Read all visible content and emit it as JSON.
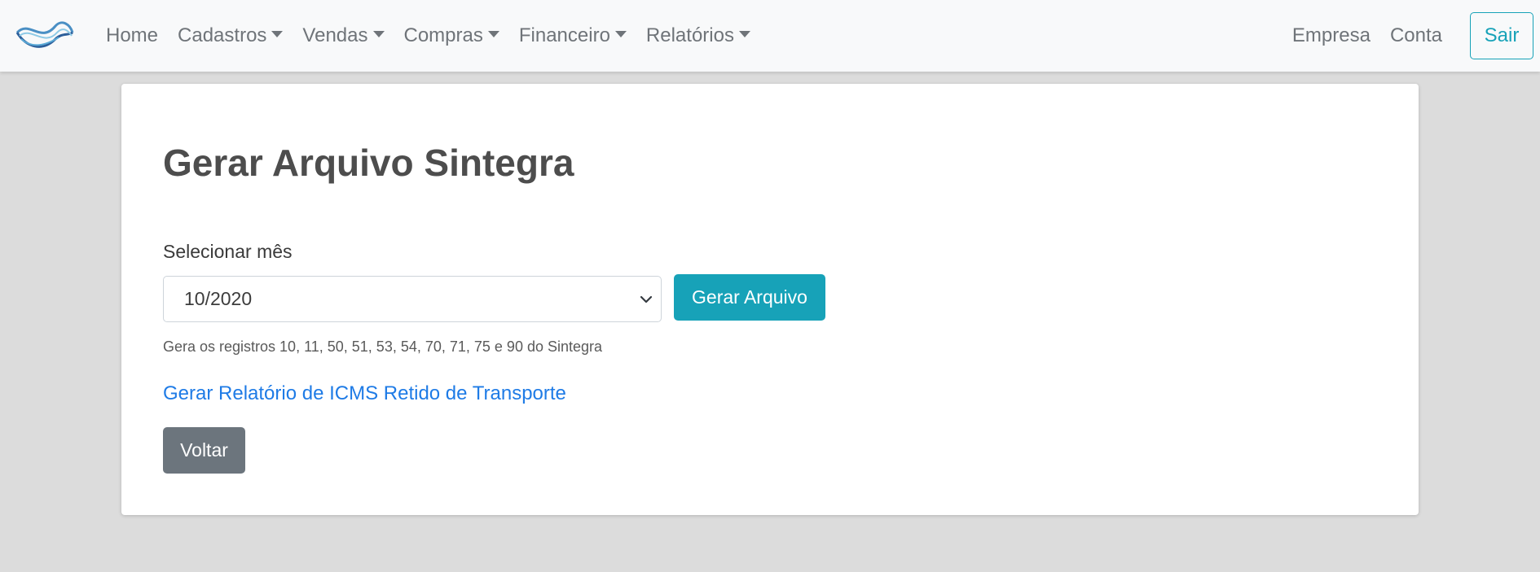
{
  "navbar": {
    "logo_icon": "wave-logo-icon",
    "menu": [
      {
        "label": "Home",
        "dropdown": false
      },
      {
        "label": "Cadastros",
        "dropdown": true
      },
      {
        "label": "Vendas",
        "dropdown": true
      },
      {
        "label": "Compras",
        "dropdown": true
      },
      {
        "label": "Financeiro",
        "dropdown": true
      },
      {
        "label": "Relatórios",
        "dropdown": true
      }
    ],
    "right": {
      "empresa": "Empresa",
      "conta": "Conta",
      "sair": "Sair"
    }
  },
  "main": {
    "title": "Gerar Arquivo Sintegra",
    "month_label": "Selecionar mês",
    "month_selected": "10/2020",
    "generate_button": "Gerar Arquivo",
    "help_text": "Gera os registros 10, 11, 50, 51, 53, 54, 70, 71, 75 e 90 do Sintegra",
    "icms_link": "Gerar Relatório de ICMS Retido de Transporte",
    "back_button": "Voltar"
  },
  "colors": {
    "accent": "#17a2b8",
    "link": "#1e7be6",
    "secondary": "#6c757d",
    "page_bg": "#dcdcdc",
    "navbar_bg": "#f8f9fa"
  }
}
